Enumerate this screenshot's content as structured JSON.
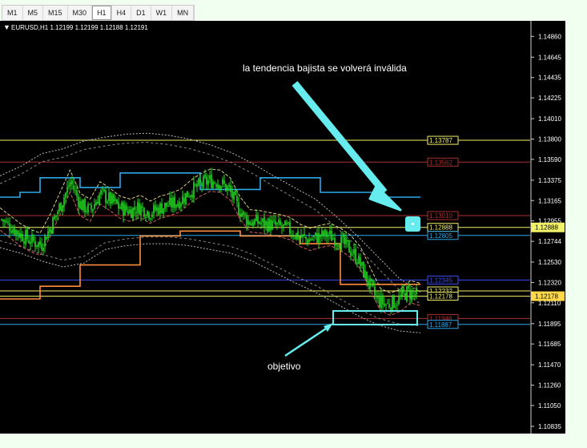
{
  "toolbar": {
    "timeframes": [
      "M1",
      "M5",
      "M15",
      "M30",
      "H1",
      "H4",
      "D1",
      "W1",
      "MN"
    ],
    "active": "H1"
  },
  "chart_header": {
    "symbol_info": "EURUSD,H1  1.12199 1.12199 1.12188 1.12191"
  },
  "annotations": {
    "top_note": "la tendencia bajista se volverá inválida",
    "target_note": "objetivo"
  },
  "colors": {
    "background": "#000000",
    "candles": "#22dd22",
    "arrow": "#66ecee",
    "envelope": "#b8b8b8",
    "channel_orange": "#ff8c3a",
    "channel_blue": "#2ea8e8",
    "hline_yellow": "#f2f26a",
    "hline_red": "#a83030",
    "hline_blue": "#3a4cf0"
  },
  "chart_data": {
    "type": "candlestick",
    "symbol": "EURUSD",
    "timeframe": "H1",
    "ohlc_last": {
      "open": 1.12199,
      "high": 1.12199,
      "low": 1.12188,
      "close": 1.12191
    },
    "y_axis": {
      "tick_labels": [
        "1.14860",
        "1.14645",
        "1.14435",
        "1.14225",
        "1.14010",
        "1.13800",
        "1.13590",
        "1.13375",
        "1.13165",
        "1.12955",
        "1.12744",
        "1.12530",
        "1.12320",
        "1.12110",
        "1.11895",
        "1.11685",
        "1.11470",
        "1.11260",
        "1.11050",
        "1.10835"
      ],
      "range": [
        1.1076,
        1.1502
      ]
    },
    "current_price": "1.12178",
    "current_price_alt": "1.12888",
    "price_lines": [
      {
        "label": "1.13787",
        "value": 1.13787,
        "color": "#f2f26a"
      },
      {
        "label": "1.13562",
        "value": 1.13562,
        "color": "#a83030"
      },
      {
        "label": "1.13010",
        "value": 1.1301,
        "color": "#a83030"
      },
      {
        "label": "1.12888",
        "value": 1.12888,
        "color": "#f2f26a"
      },
      {
        "label": "1.12805",
        "value": 1.12805,
        "color": "#2ea8e8"
      },
      {
        "label": "1.12345",
        "value": 1.12345,
        "color": "#3a4cf0"
      },
      {
        "label": "1.12232",
        "value": 1.12232,
        "color": "#f2f26a"
      },
      {
        "label": "1.12178",
        "value": 1.12178,
        "color": "#f2f26a"
      },
      {
        "label": "1.11948",
        "value": 1.11948,
        "color": "#a83030"
      },
      {
        "label": "1.11887",
        "value": 1.11887,
        "color": "#2ea8e8"
      }
    ],
    "trend_path": [
      1.1297,
      1.1289,
      1.1281,
      1.1275,
      1.1271,
      1.129,
      1.1313,
      1.1336,
      1.1312,
      1.1306,
      1.1324,
      1.1317,
      1.1309,
      1.1306,
      1.131,
      1.1304,
      1.1309,
      1.1312,
      1.1316,
      1.1325,
      1.1332,
      1.1337,
      1.1336,
      1.1328,
      1.1308,
      1.1295,
      1.1294,
      1.1292,
      1.129,
      1.1287,
      1.128,
      1.1276,
      1.1279,
      1.1281,
      1.1276,
      1.1269,
      1.1257,
      1.1235,
      1.1214,
      1.1209,
      1.1213,
      1.1222,
      1.1219
    ],
    "upper_channel": [
      1.132,
      1.1325,
      1.134,
      1.134,
      1.133,
      1.133,
      1.1345,
      1.1345,
      1.1345,
      1.1345,
      1.1328,
      1.1328,
      1.1328,
      1.134,
      1.134,
      1.134,
      1.1325,
      1.1325,
      1.1325,
      1.132,
      1.132
    ],
    "lower_channel": [
      1.1215,
      1.1215,
      1.1228,
      1.1228,
      1.125,
      1.125,
      1.125,
      1.128,
      1.128,
      1.1285,
      1.1285,
      1.1285,
      1.128,
      1.128,
      1.128,
      1.1272,
      1.1272,
      1.123,
      1.123,
      1.123,
      1.123
    ],
    "envelope_upper": [
      1.1342,
      1.1352,
      1.1365,
      1.137,
      1.1378,
      1.1382,
      1.1385,
      1.1386,
      1.1384,
      1.138,
      1.1374,
      1.1366,
      1.1355,
      1.1342,
      1.133,
      1.1318,
      1.13,
      1.128,
      1.1258,
      1.1236,
      1.1222
    ],
    "envelope_lower": [
      1.1268,
      1.1262,
      1.1254,
      1.1248,
      1.1252,
      1.1266,
      1.127,
      1.1272,
      1.1272,
      1.127,
      1.1266,
      1.1262,
      1.1254,
      1.1243,
      1.1232,
      1.1222,
      1.121,
      1.1198,
      1.1188,
      1.1182,
      1.118
    ]
  }
}
